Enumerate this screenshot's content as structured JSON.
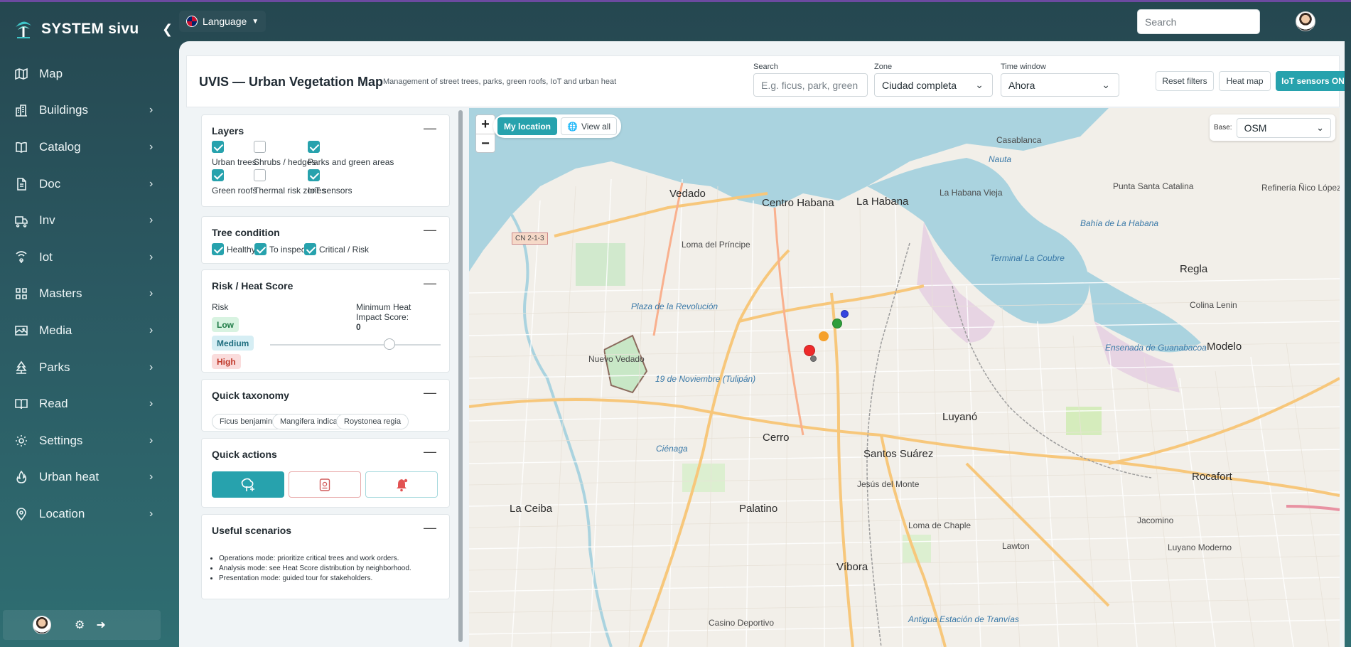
{
  "app": {
    "name": "SYSTEM sivu"
  },
  "sidebar": {
    "items": [
      {
        "label": "Map",
        "icon": "map-icon",
        "has_children": false
      },
      {
        "label": "Buildings",
        "icon": "buildings-icon",
        "has_children": true
      },
      {
        "label": "Catalog",
        "icon": "book-icon",
        "has_children": true
      },
      {
        "label": "Doc",
        "icon": "document-icon",
        "has_children": true
      },
      {
        "label": "Inv",
        "icon": "truck-icon",
        "has_children": true
      },
      {
        "label": "Iot",
        "icon": "iot-icon",
        "has_children": true
      },
      {
        "label": "Masters",
        "icon": "grid-icon",
        "has_children": true
      },
      {
        "label": "Media",
        "icon": "image-icon",
        "has_children": true
      },
      {
        "label": "Parks",
        "icon": "park-icon",
        "has_children": true
      },
      {
        "label": "Read",
        "icon": "open-book-icon",
        "has_children": true
      },
      {
        "label": "Settings",
        "icon": "settings-icon",
        "has_children": true
      },
      {
        "label": "Urban heat",
        "icon": "heat-icon",
        "has_children": true
      },
      {
        "label": "Location",
        "icon": "location-pin-icon",
        "has_children": true
      }
    ]
  },
  "topbar": {
    "language_label": "Language",
    "search_placeholder": "Search"
  },
  "header": {
    "title": "UVIS — Urban Vegetation Map",
    "subtitle": "Management of street trees, parks, green roofs, IoT and urban heat",
    "search": {
      "label": "Search",
      "placeholder": "E.g. ficus, park, green roof..."
    },
    "zone": {
      "label": "Zone",
      "value": "Ciudad completa"
    },
    "time_window": {
      "label": "Time window",
      "value": "Ahora"
    },
    "buttons": {
      "reset": "Reset filters",
      "heatmap": "Heat map",
      "iot": "IoT sensors ON"
    }
  },
  "panel": {
    "layers": {
      "title": "Layers",
      "items": [
        {
          "label": "Urban trees",
          "checked": true
        },
        {
          "label": "Shrubs / hedges",
          "checked": false
        },
        {
          "label": "Parks and green areas",
          "checked": true
        },
        {
          "label": "Green roofs",
          "checked": true
        },
        {
          "label": "Thermal risk zones",
          "checked": false
        },
        {
          "label": "IoT sensors",
          "checked": true
        }
      ]
    },
    "tree_condition": {
      "title": "Tree condition",
      "items": [
        {
          "label": "Healthy",
          "checked": true
        },
        {
          "label": "To inspect",
          "checked": true
        },
        {
          "label": "Critical / Risk",
          "checked": true
        }
      ]
    },
    "risk": {
      "title": "Risk / Heat Score",
      "risk_label": "Risk",
      "levels": [
        {
          "label": "Low",
          "bg": "#d8f3e1",
          "fg": "#1e7a45"
        },
        {
          "label": "Medium",
          "bg": "#d6eef4",
          "fg": "#1d6d7e"
        },
        {
          "label": "High",
          "bg": "#fadcdc",
          "fg": "#c0392b"
        }
      ],
      "min_label": "Minimum Heat Impact Score:",
      "min_value": "0"
    },
    "taxonomy": {
      "title": "Quick taxonomy",
      "chips": [
        "Ficus benjamina",
        "Mangifera indica",
        "Roystonea regia"
      ]
    },
    "quick_actions": {
      "title": "Quick actions",
      "actions": [
        {
          "icon": "add-tree-icon"
        },
        {
          "icon": "report-icon"
        },
        {
          "icon": "alert-bell-icon"
        }
      ]
    },
    "scenarios": {
      "title": "Useful scenarios",
      "items": [
        "Operations mode: prioritize critical trees and work orders.",
        "Analysis mode: see Heat Score distribution by neighborhood.",
        "Presentation mode: guided tour for stakeholders."
      ]
    }
  },
  "map": {
    "my_location": "My location",
    "view_all": "View all",
    "base_label": "Base:",
    "base_value": "OSM",
    "zoom_in": "+",
    "zoom_out": "−",
    "labels": [
      "La Habana",
      "Centro Habana",
      "La Habana Vieja",
      "Vedado",
      "Casablanca",
      "Regla",
      "Nuevo Vedado",
      "Cerro",
      "Santos Suárez",
      "Luyanó",
      "Jesús del Monte",
      "La Ceiba",
      "Palatino",
      "Víbora",
      "Lawton",
      "Rocafort",
      "Jacomino",
      "Luyano Moderno",
      "Modelo",
      "Casino Deportivo",
      "Loma del Príncipe",
      "Plaza de la Revolución",
      "Ciénaga",
      "Terminal La Coubre",
      "Nauta",
      "19 de Noviembre (Tulipán)",
      "Refinería Ñico López",
      "Punta Santa Catalina",
      "Bahía de La Habana",
      "Ensenada de Guanabacoa",
      "Colina Lenin",
      "Antigua Estación de Tranvías",
      "Loma de Chaple",
      "CN 2-1-3"
    ]
  },
  "colors": {
    "accent": "#27a2ad",
    "sidebar": "#2b5962"
  }
}
